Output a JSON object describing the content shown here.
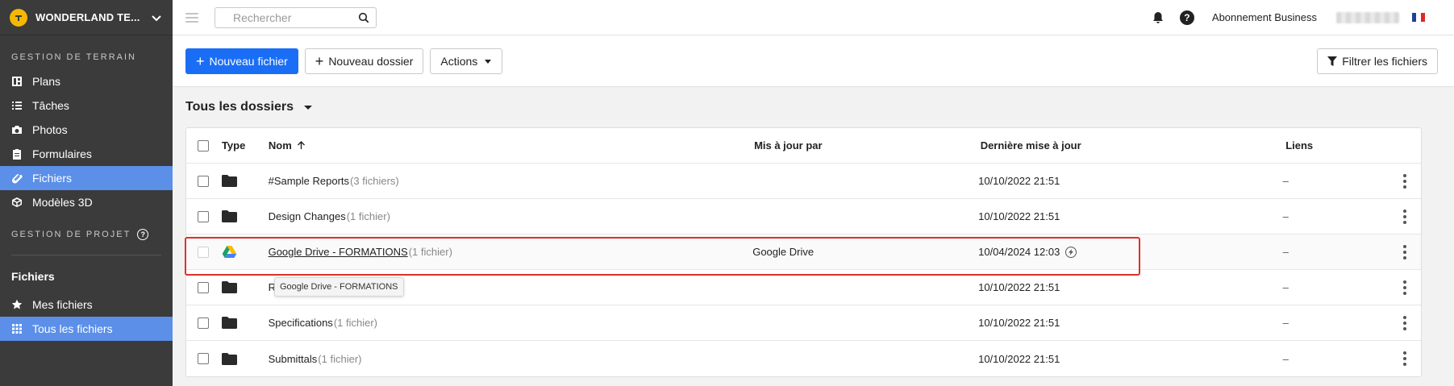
{
  "workspace": {
    "name": "WONDERLAND TE..."
  },
  "sidebar": {
    "section_terrain": "GESTION DE TERRAIN",
    "items": [
      {
        "label": "Plans",
        "icon": "plans-icon"
      },
      {
        "label": "Tâches",
        "icon": "list-icon"
      },
      {
        "label": "Photos",
        "icon": "camera-icon"
      },
      {
        "label": "Formulaires",
        "icon": "clipboard-icon"
      },
      {
        "label": "Fichiers",
        "icon": "paperclip-icon",
        "active": true
      },
      {
        "label": "Modèles 3D",
        "icon": "cube-icon"
      }
    ],
    "section_projet": "GESTION DE PROJET",
    "files_title": "Fichiers",
    "files_items": [
      {
        "label": "Mes fichiers",
        "icon": "star-icon"
      },
      {
        "label": "Tous les fichiers",
        "icon": "grid-icon",
        "active": true
      }
    ]
  },
  "topbar": {
    "search_placeholder": "Rechercher",
    "subscription": "Abonnement Business"
  },
  "toolbar": {
    "new_file": "Nouveau fichier",
    "new_folder": "Nouveau dossier",
    "actions": "Actions",
    "filter": "Filtrer les fichiers"
  },
  "folder_selector": "Tous les dossiers",
  "table": {
    "headers": {
      "type": "Type",
      "name": "Nom",
      "updated_by": "Mis à jour par",
      "last_update": "Dernière mise à jour",
      "links": "Liens"
    },
    "rows": [
      {
        "name": "#Sample Reports",
        "count": "(3 fichiers)",
        "updated_by": "",
        "date": "10/10/2022 21:51",
        "links": "–"
      },
      {
        "name": "Design Changes",
        "count": "(1 fichier)",
        "updated_by": "",
        "date": "10/10/2022 21:51",
        "links": "–"
      },
      {
        "name": "Google Drive - FORMATIONS",
        "count": "(1 fichier)",
        "updated_by": "Google Drive",
        "date": "10/04/2024 12:03",
        "links": "–"
      },
      {
        "name": "R",
        "count": "",
        "updated_by": "",
        "date": "10/10/2022 21:51",
        "links": "–"
      },
      {
        "name": "Specifications",
        "count": "(1 fichier)",
        "updated_by": "",
        "date": "10/10/2022 21:51",
        "links": "–"
      },
      {
        "name": "Submittals",
        "count": "(1 fichier)",
        "updated_by": "",
        "date": "10/10/2022 21:51",
        "links": "–"
      }
    ]
  },
  "tooltip": "Google Drive - FORMATIONS",
  "colors": {
    "primary": "#1a6ef5",
    "sidebar_bg": "#3b3b3b",
    "sidebar_active": "#5b8fe8",
    "highlight": "#e0302a",
    "logo": "#f5b800"
  }
}
